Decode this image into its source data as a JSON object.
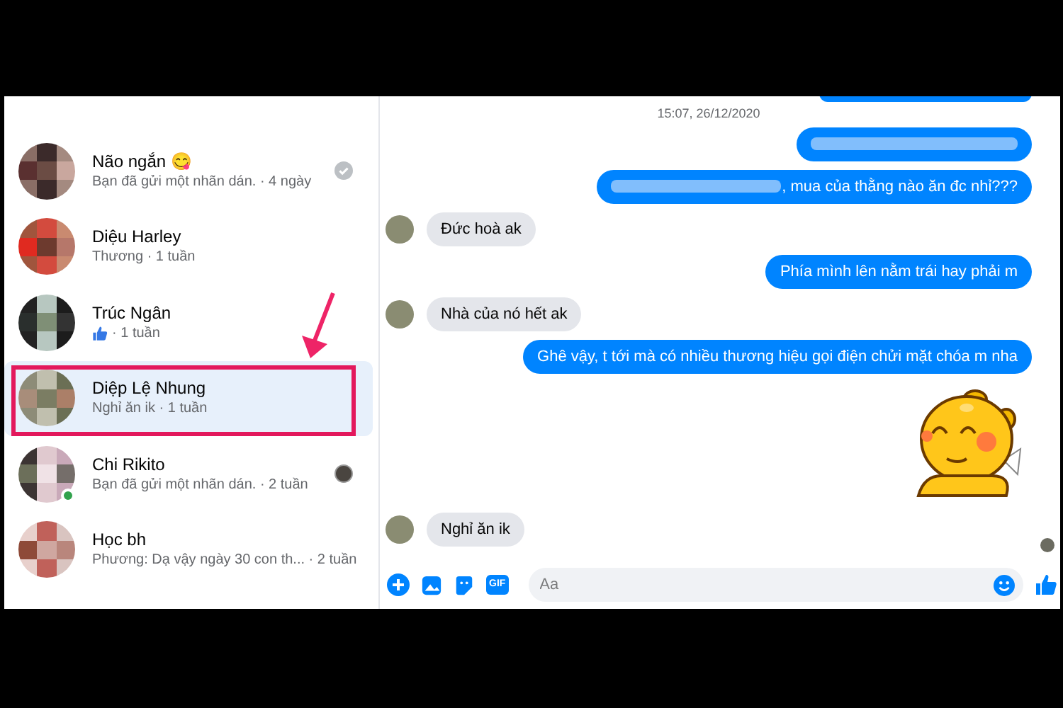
{
  "conversations": [
    {
      "name": "Não ngắn 😋",
      "kind": "text",
      "preview": "Bạn đã gửi một nhãn dán. · 4 ngày",
      "seen_check": true,
      "seen_avatar": false,
      "online": false,
      "selected": false,
      "highlighted": false
    },
    {
      "name": "Diệu Harley",
      "kind": "text",
      "preview": "Thương · 1 tuần",
      "seen_check": false,
      "seen_avatar": false,
      "online": false,
      "selected": false,
      "highlighted": false
    },
    {
      "name": "Trúc Ngân",
      "kind": "like",
      "preview": "· 1 tuần",
      "seen_check": false,
      "seen_avatar": false,
      "online": false,
      "selected": false,
      "highlighted": false
    },
    {
      "name": "Diệp Lệ Nhung",
      "kind": "text",
      "preview": "Nghỉ ăn ik · 1 tuần",
      "seen_check": false,
      "seen_avatar": false,
      "online": false,
      "selected": true,
      "highlighted": true
    },
    {
      "name": "Chi Rikito",
      "kind": "text",
      "preview": "Bạn đã gửi một nhãn dán. · 2 tuần",
      "seen_check": false,
      "seen_avatar": true,
      "online": true,
      "selected": false,
      "highlighted": false
    },
    {
      "name": "Học bh",
      "kind": "text",
      "preview": "Phương: Dạ vậy ngày 30 con th... · 2 tuần",
      "seen_check": false,
      "seen_avatar": false,
      "online": false,
      "selected": false,
      "highlighted": false
    }
  ],
  "messages": [
    {
      "kind": "timestamp",
      "text": "15:07, 26/12/2020"
    },
    {
      "kind": "outgoing",
      "redacted": true
    },
    {
      "kind": "outgoing",
      "redacted": true,
      "text": ", mua của thằng nào ăn đc nhỉ???"
    },
    {
      "kind": "incoming",
      "text": "Đức hoà ak"
    },
    {
      "kind": "outgoing",
      "redacted": false,
      "text": "Phía mình lên nằm trái hay phải m"
    },
    {
      "kind": "incoming",
      "text": "Nhà của nó hết ak"
    },
    {
      "kind": "outgoing",
      "redacted": false,
      "text": "Ghê vậy, t tới mà có nhiều thương hiệu gọi điện chửi mặt chóa m nha"
    },
    {
      "kind": "sticker"
    },
    {
      "kind": "incoming",
      "text": "Nghỉ ăn ik"
    }
  ],
  "composer": {
    "gif_label": "GIF",
    "placeholder": "Aa"
  }
}
